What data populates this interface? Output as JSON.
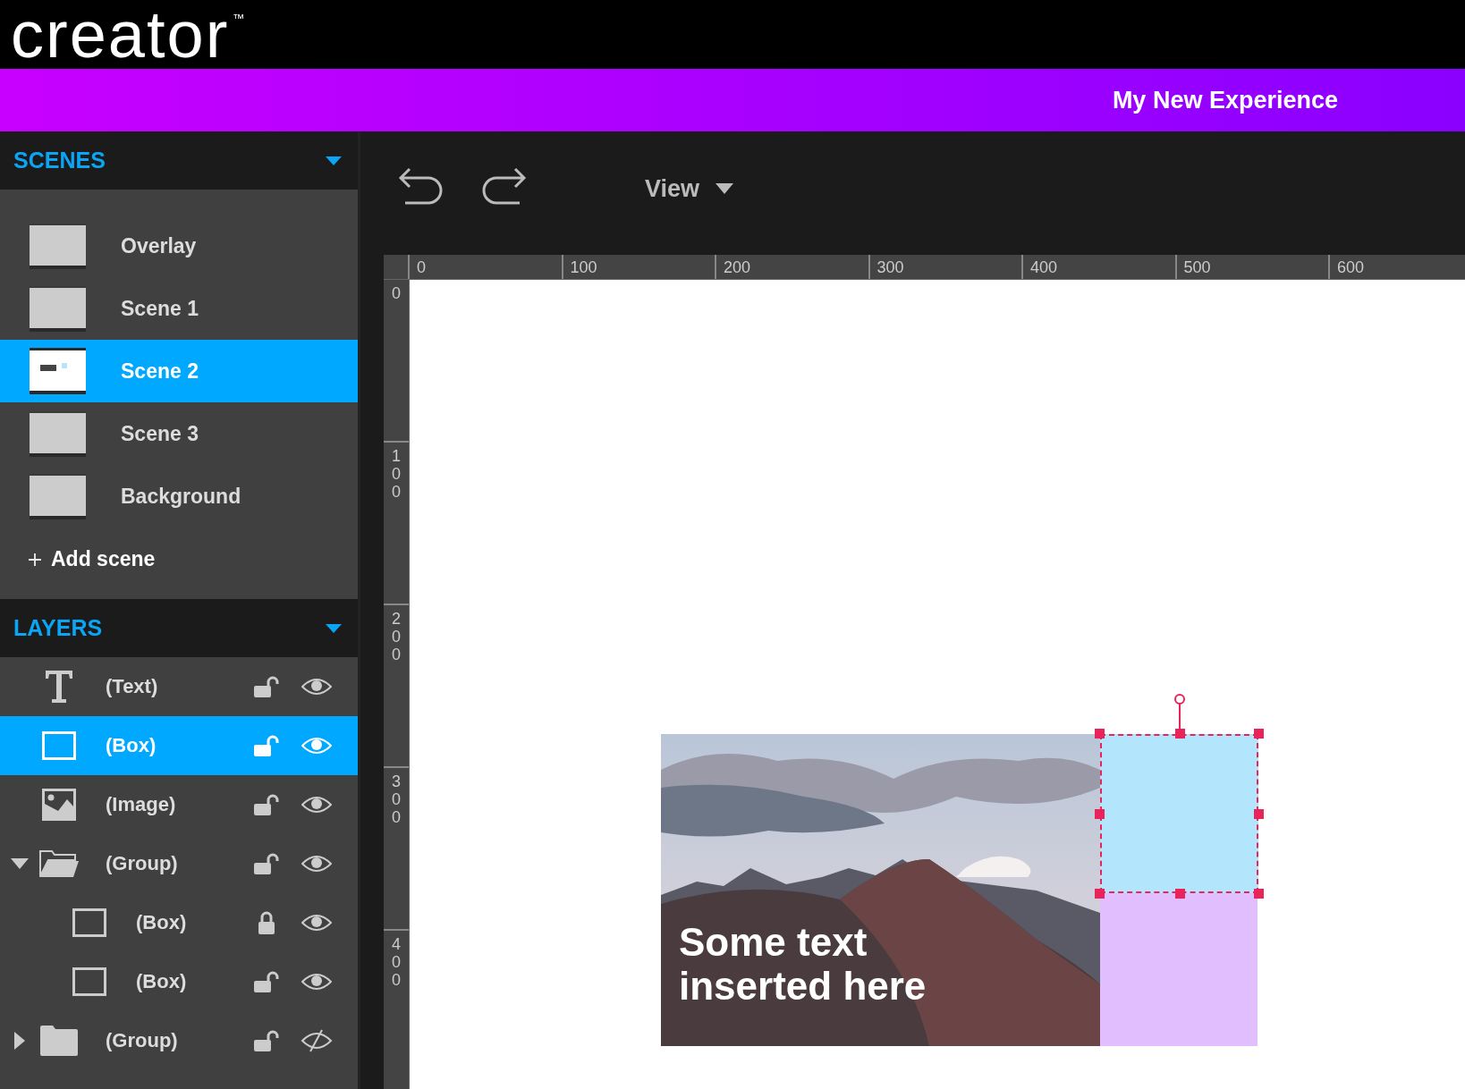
{
  "app": {
    "logo": "creator",
    "logo_mark": "™"
  },
  "project": {
    "title": "My New Experience"
  },
  "scenes": {
    "title": "SCENES",
    "add_label": "Add scene",
    "items": [
      {
        "label": "Overlay",
        "selected": false,
        "preview": false
      },
      {
        "label": "Scene 1",
        "selected": false,
        "preview": false
      },
      {
        "label": "Scene 2",
        "selected": true,
        "preview": true
      },
      {
        "label": "Scene 3",
        "selected": false,
        "preview": false
      },
      {
        "label": "Background",
        "selected": false,
        "preview": false
      }
    ]
  },
  "layers": {
    "title": "LAYERS",
    "items": [
      {
        "label": "(Text)",
        "kind": "text",
        "locked": false,
        "visible": true,
        "selected": false
      },
      {
        "label": "(Box)",
        "kind": "box",
        "locked": false,
        "visible": true,
        "selected": true
      },
      {
        "label": "(Image)",
        "kind": "image",
        "locked": false,
        "visible": true,
        "selected": false
      },
      {
        "label": "(Group)",
        "kind": "group",
        "locked": false,
        "visible": true,
        "selected": false,
        "expanded": true,
        "children": [
          {
            "label": "(Box)",
            "kind": "box",
            "locked": true,
            "visible": true,
            "selected": false
          },
          {
            "label": "(Box)",
            "kind": "box",
            "locked": false,
            "visible": true,
            "selected": false
          }
        ]
      },
      {
        "label": "(Group)",
        "kind": "group",
        "locked": false,
        "visible": false,
        "selected": false,
        "expanded": false
      }
    ]
  },
  "toolbar": {
    "view_menu": "View"
  },
  "ruler": {
    "x_labels": [
      "0",
      "100",
      "200",
      "300",
      "400",
      "500",
      "600"
    ],
    "y_labels": [
      "0",
      "100",
      "200",
      "300",
      "400"
    ]
  },
  "canvas": {
    "elements": [
      {
        "kind": "image"
      },
      {
        "kind": "text",
        "text": "Some text\ninserted here"
      },
      {
        "kind": "box",
        "color": "#b3e5fc",
        "selected": true
      },
      {
        "kind": "box",
        "color": "#e1bfff",
        "selected": false
      }
    ]
  }
}
